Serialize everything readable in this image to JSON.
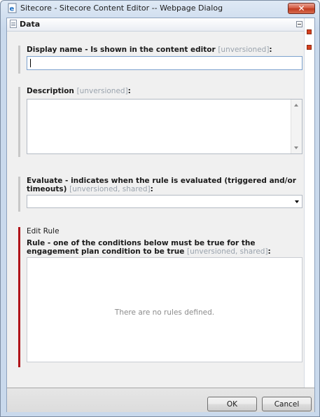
{
  "window": {
    "title": "Sitecore - Sitecore Content Editor -- Webpage Dialog",
    "close_glyph": "✕"
  },
  "section": {
    "title": "Data"
  },
  "fields": {
    "display_name": {
      "label": "Display name - Is shown in the content editor",
      "meta": "[unversioned]",
      "suffix": ":",
      "value": ""
    },
    "description": {
      "label": "Description",
      "meta": "[unversioned]",
      "suffix": ":",
      "value": ""
    },
    "evaluate": {
      "label": "Evaluate - indicates when the rule is evaluated (triggered and/or timeouts)",
      "meta": "[unversioned, shared]",
      "suffix": ":",
      "selected": ""
    },
    "rule": {
      "edit_link": "Edit Rule",
      "label": "Rule - one of the conditions below must be true for the engagement plan condition to be true",
      "meta": "[unversioned, shared]",
      "suffix": ":",
      "empty_text": "There are no rules defined."
    }
  },
  "buttons": {
    "ok": "OK",
    "cancel": "Cancel"
  },
  "icons": {
    "title": "ie-page-icon",
    "section": "document-icon",
    "collapse": "collapse-icon",
    "close": "close-icon"
  },
  "colors": {
    "accent_red": "#b0141a",
    "side_marker": "#d6401f"
  }
}
